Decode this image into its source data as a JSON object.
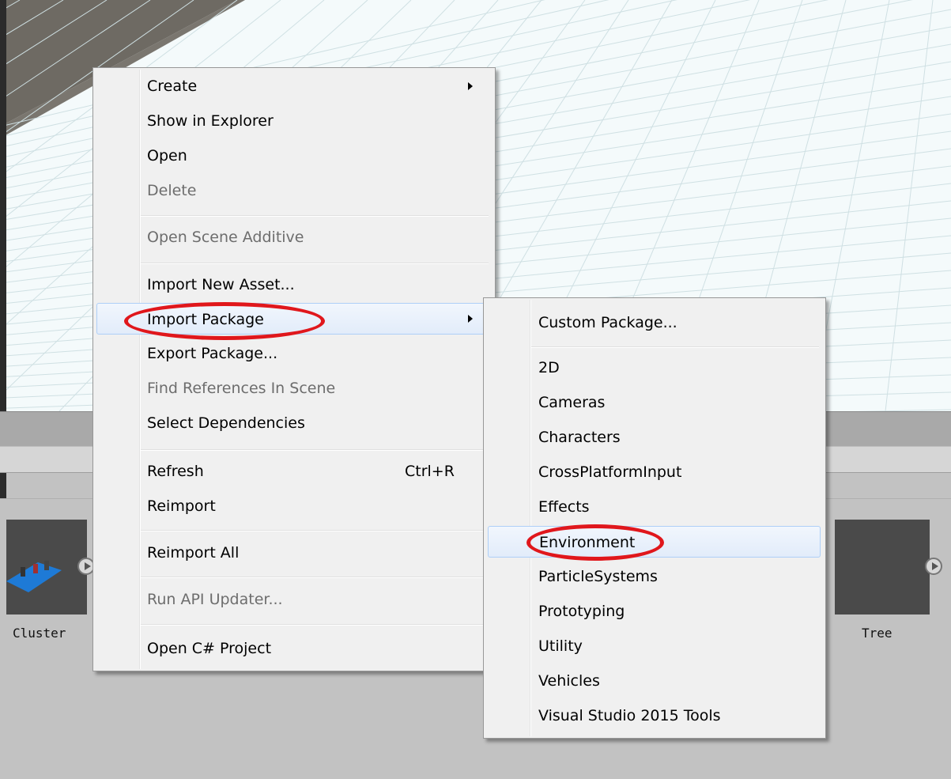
{
  "assets": [
    {
      "label": "Cluster"
    },
    {
      "label": "Tree"
    }
  ],
  "context_menu": {
    "items": [
      {
        "label": "Create",
        "enabled": true,
        "submenu": true
      },
      {
        "label": "Show in Explorer",
        "enabled": true
      },
      {
        "label": "Open",
        "enabled": true
      },
      {
        "label": "Delete",
        "enabled": false
      },
      {
        "label": "Open Scene Additive",
        "enabled": false
      },
      {
        "label": "Import New Asset...",
        "enabled": true
      },
      {
        "label": "Import Package",
        "enabled": true,
        "submenu": true,
        "highlighted": true,
        "circled": true
      },
      {
        "label": "Export Package...",
        "enabled": true
      },
      {
        "label": "Find References In Scene",
        "enabled": false
      },
      {
        "label": "Select Dependencies",
        "enabled": true
      },
      {
        "label": "Refresh",
        "enabled": true,
        "shortcut": "Ctrl+R"
      },
      {
        "label": "Reimport",
        "enabled": true
      },
      {
        "label": "Reimport All",
        "enabled": true
      },
      {
        "label": "Run API Updater...",
        "enabled": false
      },
      {
        "label": "Open C# Project",
        "enabled": true
      }
    ]
  },
  "submenu": {
    "items": [
      {
        "label": "Custom Package..."
      },
      {
        "label": "2D"
      },
      {
        "label": "Cameras"
      },
      {
        "label": "Characters"
      },
      {
        "label": "CrossPlatformInput"
      },
      {
        "label": "Effects"
      },
      {
        "label": "Environment",
        "highlighted": true,
        "circled": true
      },
      {
        "label": "ParticleSystems"
      },
      {
        "label": "Prototyping"
      },
      {
        "label": "Utility"
      },
      {
        "label": "Vehicles"
      },
      {
        "label": "Visual Studio 2015 Tools"
      }
    ]
  },
  "colors": {
    "annotation": "#e0171c",
    "highlight_border": "#aecff7",
    "disabled_text": "#6d6d6d"
  }
}
